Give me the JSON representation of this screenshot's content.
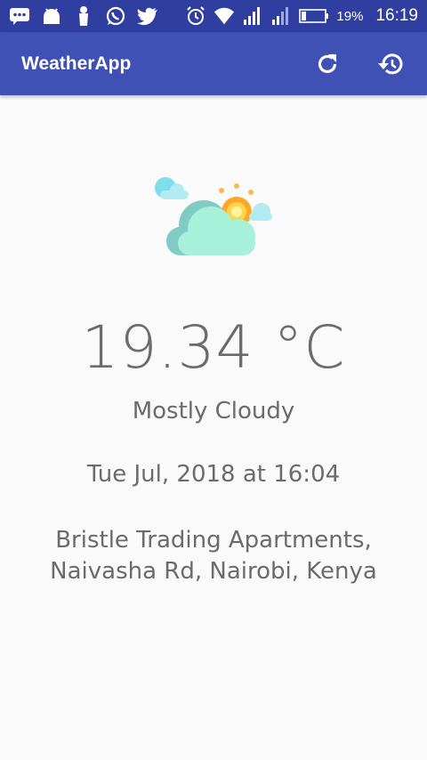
{
  "status_bar": {
    "left_icons": [
      "messaging-icon",
      "android-icon",
      "notification-icon",
      "whatsapp-icon",
      "twitter-icon"
    ],
    "right_icons": [
      "alarm-icon",
      "wifi-icon",
      "signal-icon",
      "signal-weak-icon",
      "battery-icon"
    ],
    "battery": "19%",
    "time": "16:19"
  },
  "app_bar": {
    "title": "WeatherApp",
    "actions": [
      "refresh-icon",
      "history-icon"
    ]
  },
  "weather": {
    "icon": "partly-cloudy-icon",
    "temperature": "19.34 °C",
    "condition": "Mostly Cloudy",
    "datetime": "Tue Jul, 2018 at 16:04",
    "address_line1": "Bristle Trading Apartments,",
    "address_line2": "Naivasha Rd, Nairobi, Kenya"
  },
  "colors": {
    "status_bar": "#303f9f",
    "app_bar": "#3f51b5",
    "background": "#fafafa",
    "text": "#6b6b6b"
  }
}
